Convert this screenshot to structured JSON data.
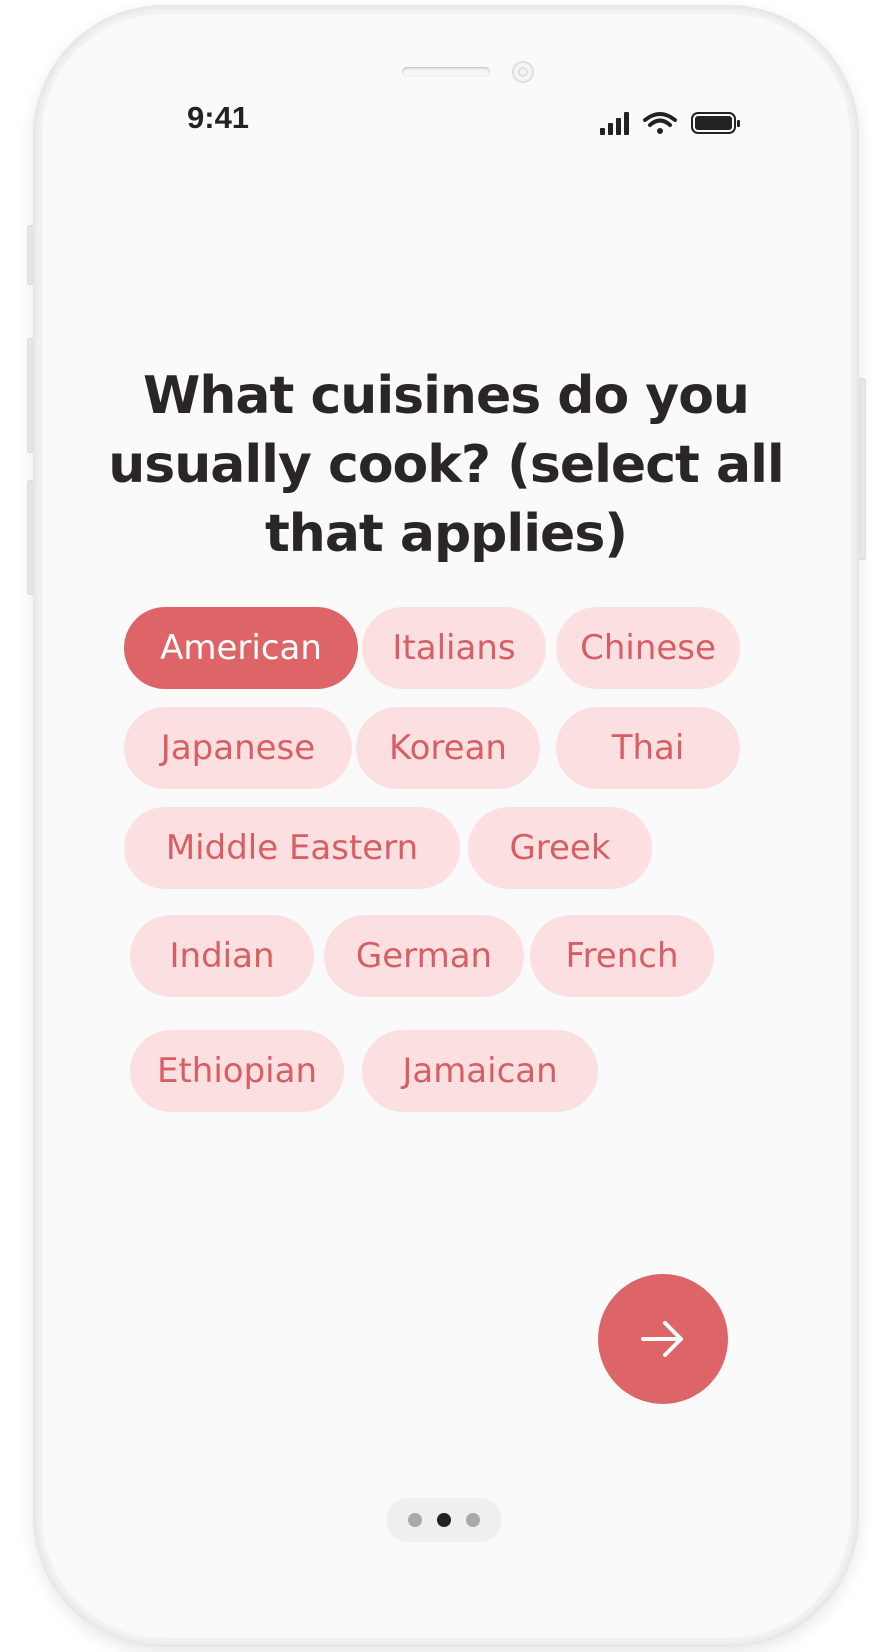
{
  "status_bar": {
    "time": "9:41",
    "icons": [
      "cellular-signal-icon",
      "wifi-icon",
      "battery-icon"
    ]
  },
  "question": {
    "line1": "What cuisines do you",
    "line2": "usually cook? (select all",
    "line3": "that applies)"
  },
  "cuisines": [
    {
      "label": "American",
      "selected": true
    },
    {
      "label": "Italians",
      "selected": false
    },
    {
      "label": "Chinese",
      "selected": false
    },
    {
      "label": "Japanese",
      "selected": false
    },
    {
      "label": "Korean",
      "selected": false
    },
    {
      "label": "Thai",
      "selected": false
    },
    {
      "label": "Middle Eastern",
      "selected": false
    },
    {
      "label": "Greek",
      "selected": false
    },
    {
      "label": "Indian",
      "selected": false
    },
    {
      "label": "German",
      "selected": false
    },
    {
      "label": "French",
      "selected": false
    },
    {
      "label": "Ethiopian",
      "selected": false
    },
    {
      "label": "Jamaican",
      "selected": false
    }
  ],
  "next_button": {
    "icon": "arrow-right-icon"
  },
  "pagination": {
    "total": 3,
    "current": 2
  },
  "colors": {
    "accent": "#dd6467",
    "chip_bg": "#fce0e1",
    "chip_text": "#d75f63",
    "title": "#2a2626",
    "screen_bg": "#fafafa"
  }
}
